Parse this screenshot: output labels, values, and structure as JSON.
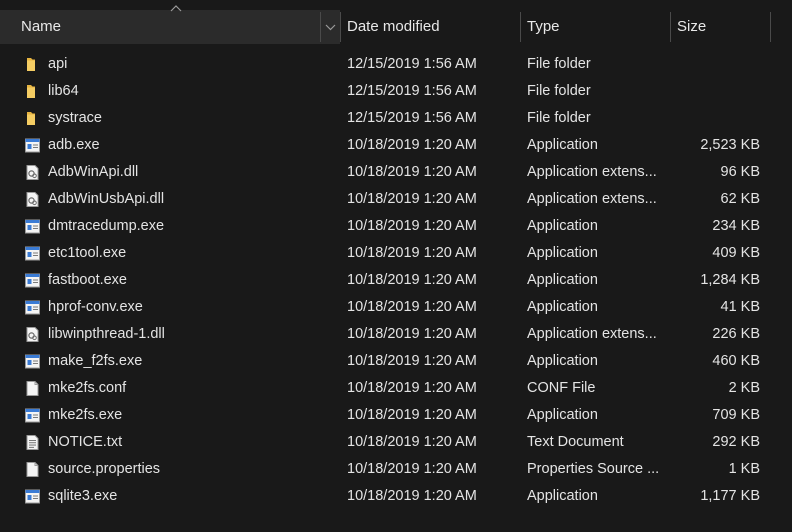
{
  "columns": {
    "name": "Name",
    "date": "Date modified",
    "type": "Type",
    "size": "Size"
  },
  "files": [
    {
      "name": "api",
      "date": "12/15/2019 1:56 AM",
      "type": "File folder",
      "size": "",
      "icon": "folder-icon"
    },
    {
      "name": "lib64",
      "date": "12/15/2019 1:56 AM",
      "type": "File folder",
      "size": "",
      "icon": "folder-icon"
    },
    {
      "name": "systrace",
      "date": "12/15/2019 1:56 AM",
      "type": "File folder",
      "size": "",
      "icon": "folder-icon"
    },
    {
      "name": "adb.exe",
      "date": "10/18/2019 1:20 AM",
      "type": "Application",
      "size": "2,523 KB",
      "icon": "application-icon"
    },
    {
      "name": "AdbWinApi.dll",
      "date": "10/18/2019 1:20 AM",
      "type": "Application extens...",
      "size": "96 KB",
      "icon": "dll-icon"
    },
    {
      "name": "AdbWinUsbApi.dll",
      "date": "10/18/2019 1:20 AM",
      "type": "Application extens...",
      "size": "62 KB",
      "icon": "dll-icon"
    },
    {
      "name": "dmtracedump.exe",
      "date": "10/18/2019 1:20 AM",
      "type": "Application",
      "size": "234 KB",
      "icon": "application-icon"
    },
    {
      "name": "etc1tool.exe",
      "date": "10/18/2019 1:20 AM",
      "type": "Application",
      "size": "409 KB",
      "icon": "application-icon"
    },
    {
      "name": "fastboot.exe",
      "date": "10/18/2019 1:20 AM",
      "type": "Application",
      "size": "1,284 KB",
      "icon": "application-icon"
    },
    {
      "name": "hprof-conv.exe",
      "date": "10/18/2019 1:20 AM",
      "type": "Application",
      "size": "41 KB",
      "icon": "application-icon"
    },
    {
      "name": "libwinpthread-1.dll",
      "date": "10/18/2019 1:20 AM",
      "type": "Application extens...",
      "size": "226 KB",
      "icon": "dll-icon"
    },
    {
      "name": "make_f2fs.exe",
      "date": "10/18/2019 1:20 AM",
      "type": "Application",
      "size": "460 KB",
      "icon": "application-icon"
    },
    {
      "name": "mke2fs.conf",
      "date": "10/18/2019 1:20 AM",
      "type": "CONF File",
      "size": "2 KB",
      "icon": "file-icon"
    },
    {
      "name": "mke2fs.exe",
      "date": "10/18/2019 1:20 AM",
      "type": "Application",
      "size": "709 KB",
      "icon": "application-icon"
    },
    {
      "name": "NOTICE.txt",
      "date": "10/18/2019 1:20 AM",
      "type": "Text Document",
      "size": "292 KB",
      "icon": "text-document-icon"
    },
    {
      "name": "source.properties",
      "date": "10/18/2019 1:20 AM",
      "type": "Properties Source ...",
      "size": "1 KB",
      "icon": "file-icon"
    },
    {
      "name": "sqlite3.exe",
      "date": "10/18/2019 1:20 AM",
      "type": "Application",
      "size": "1,177 KB",
      "icon": "application-icon"
    }
  ],
  "colors": {
    "background": "#191919",
    "header_active": "#2b2b2b",
    "folder": "#f2c75c",
    "text": "#e4e4e4"
  }
}
